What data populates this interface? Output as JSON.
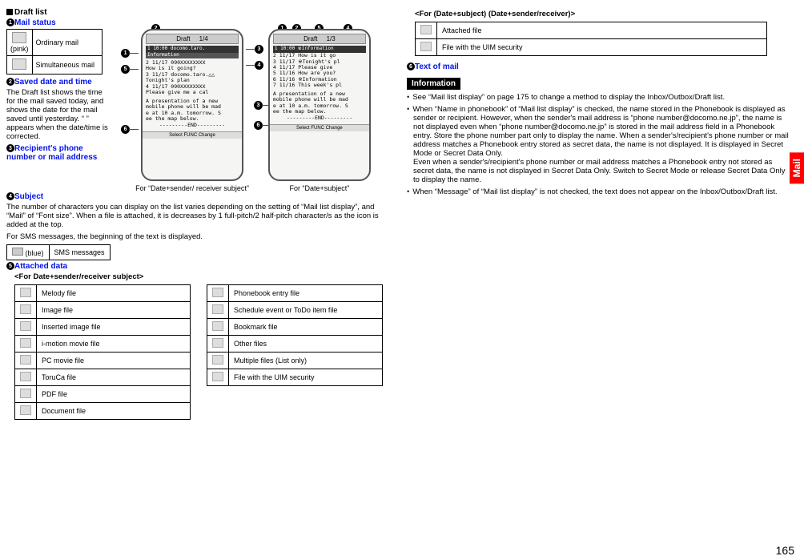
{
  "left": {
    "draft_list_title": "Draft list",
    "mail_status_label": "Mail status",
    "mail_status_rows": {
      "pink": "(pink)",
      "ordinary": "Ordinary mail",
      "simul": "Simultaneous mail"
    },
    "saved_label": "Saved date and time",
    "saved_text": "The Draft list shows the time for the mail saved today, and shows the date for the mail saved until yesterday. “        ” appears when the date/time is corrected.",
    "recipient_label": "Recipient's phone number or mail address",
    "subject_label": "Subject",
    "subject_text": "The number of characters you can display on the list varies depending on the setting of “Mail list display”, and “Mail” of “Font size”. When a file is attached, it is decreases by 1 full-pitch/2 half-pitch character/s as the icon is added at the top.",
    "sms_text": "For SMS messages, the beginning of the text is displayed.",
    "sms_row": {
      "blue": "(blue)",
      "label": "SMS messages"
    },
    "attached_label": "Attached data",
    "for_dsr_label": "<For Date+sender/receiver subject>",
    "file_left": [
      "Melody file",
      "Image file",
      "Inserted image file",
      "i-motion movie file",
      "PC movie file",
      "ToruCa file",
      "PDF file",
      "Document file"
    ],
    "file_right": [
      "Phonebook entry file",
      "Schedule event or ToDo item file",
      "Bookmark file",
      "Other files",
      "Multiple files (List only)",
      "File with the UIM security"
    ],
    "phone1": {
      "title": "Draft",
      "count": "1/4",
      "status": "1 10:00 docomo.taro.",
      "info": "Information",
      "lines": [
        "2 11/17 090XXXXXXXX",
        "  How is it going?",
        "3 11/17 docomo.taro.△△",
        "  Tonight's plan",
        "4 11/17 090XXXXXXXX",
        "  Please give me a cal",
        "A presentation of a new",
        "mobile phone will be mad",
        "e at 10 a.m. tomorrow. S",
        "ee the map below.",
        "---------END---------"
      ],
      "bottom": "Select   FUNC  Change",
      "caption": "For “Date+sender/ receiver subject”"
    },
    "phone2": {
      "title": "Draft",
      "count": "1/3",
      "status": "1 10:00 ※Information",
      "lines": [
        "2 11/17  How is it go",
        "3 11/17 ※Tonight's pl",
        "4 11/17  Please give ",
        "5 11/16  How are you?",
        "6 11/16 ※Information",
        "7 11/16  This week's pl",
        "A presentation of a new",
        "mobile phone will be mad",
        "e at 10 a.m. tomorrow. S",
        "ee the map below.",
        "---------END---------"
      ],
      "bottom": "Select   FUNC  Change",
      "caption": "For “Date+subject”"
    }
  },
  "right": {
    "section_title": "<For (Date+subject) (Date+sender/receiver)>",
    "rows": [
      "Attached file",
      "File with the UIM security"
    ],
    "text_of_mail": "Text of mail",
    "info_hd": "Information",
    "bullets": [
      "See “Mail list display” on page 175 to change a method to display the Inbox/Outbox/Draft list.",
      "When “Name in phonebook” of “Mail list display” is checked, the name stored in the Phonebook is displayed as sender or recipient. However, when the sender's mail address is “phone number@docomo.ne.jp”, the name is not displayed even when “phone number@docomo.ne.jp” is stored in the mail address field in a Phonebook entry. Store the phone number part only to display the name. When a sender's/recipient's phone number or mail address matches a Phonebook entry stored as secret data, the name is not displayed. It is displayed in Secret Mode or Secret Data Only.\nEven when a sender's/recipient's phone number or mail address matches a Phonebook entry not stored as secret data, the name is not displayed in Secret Data Only. Switch to Secret Mode or release Secret Data Only to display the name.",
      "When “Message” of “Mail list display” is not checked, the text does not appear on the Inbox/Outbox/Draft list."
    ]
  },
  "side_tab": "Mail",
  "pagenum": "165"
}
